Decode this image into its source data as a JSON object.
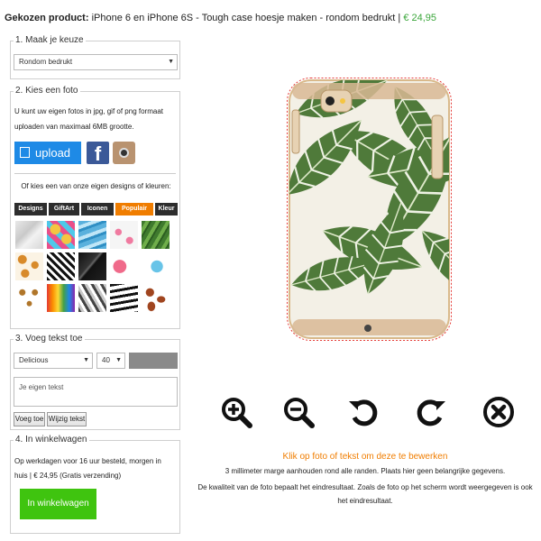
{
  "header": {
    "label": "Gekozen product:",
    "product": "iPhone 6 en iPhone 6S - Tough case hoesje maken - rondom bedrukt",
    "sep": "|",
    "price": "€ 24,95"
  },
  "section1": {
    "title": "1. Maak je keuze",
    "select_value": "Rondom bedrukt"
  },
  "section2": {
    "title": "2. Kies een foto",
    "intro": [
      "U kunt uw eigen fotos in jpg, gif of png formaat",
      "uploaden van maximaal 6MB grootte."
    ],
    "upload_label": "upload",
    "facebook_glyph": "f",
    "or_text": "Of kies een van onze eigen designs of kleuren:",
    "tabs": [
      "Designs",
      "GiftArt",
      "Iconen",
      "Populair",
      "Kleur"
    ],
    "active_tab": "Populair",
    "thumbnails": [
      "marble",
      "pineapples",
      "blue-waves",
      "flamingos",
      "palm-leaves",
      "croissants",
      "zigzag",
      "black-marble",
      "heart-halves",
      "palm-leaves-2",
      "pattern-a",
      "rainbow-drips",
      "geometric",
      "stripes",
      "lips"
    ]
  },
  "section3": {
    "title": "3. Voeg tekst toe",
    "font_value": "Delicious",
    "size_value": "40",
    "textarea_placeholder": "Je eigen tekst",
    "add_button": "Voeg toe",
    "edit_button": "Wijzig tekst",
    "swatch_color": "#8a8a8a"
  },
  "section4": {
    "title": "4. In winkelwagen",
    "delivery": [
      "Op werkdagen voor 16 uur besteld, morgen in",
      "huis | € 24,95 (Gratis verzending)"
    ],
    "cart_button": "In winkelwagen"
  },
  "preview": {
    "design": "tropical-palm-leaves",
    "tools": [
      "zoom-in",
      "zoom-out",
      "rotate-left",
      "rotate-right",
      "remove"
    ]
  },
  "info": {
    "hint": "Klik op foto of tekst om deze te bewerken",
    "margin": "3 millimeter marge aanhouden rond alle randen. Plaats hier geen belangrijke gegevens.",
    "quality": [
      "De kwaliteit van de foto bepaalt het eindresultaat. Zoals de foto op het scherm wordt weergegeven is ook",
      "het eindresultaat."
    ]
  },
  "colors": {
    "accent": "#f07d00",
    "green": "#3fc40f",
    "price": "#3aa63a",
    "upload": "#1e8ae6",
    "facebook": "#3b5998"
  }
}
